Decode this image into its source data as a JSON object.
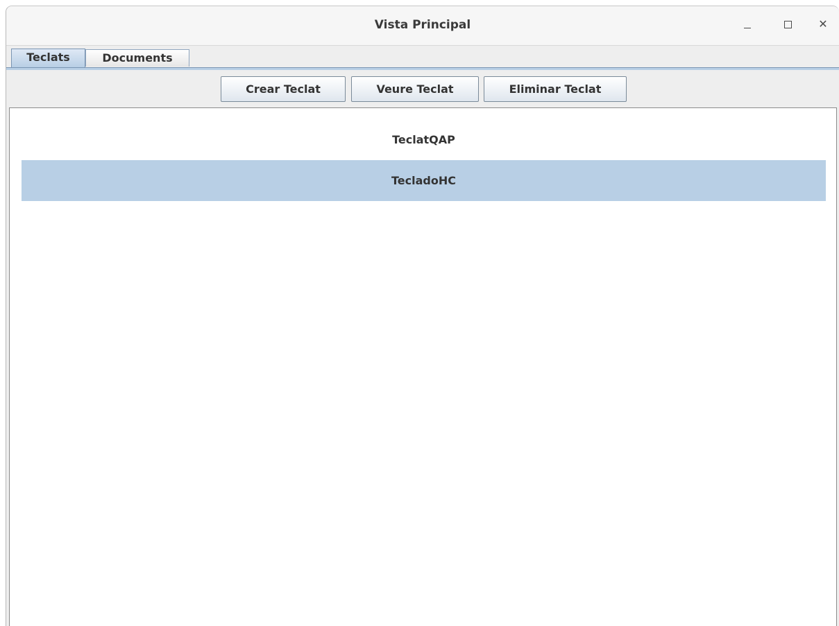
{
  "window": {
    "title": "Vista Principal",
    "controls": {
      "minimize": "minimize-icon",
      "maximize": "maximize-icon",
      "close": "close-icon",
      "close_glyph": "✕"
    }
  },
  "tabs": [
    {
      "label": "Teclats",
      "selected": true
    },
    {
      "label": "Documents",
      "selected": false
    }
  ],
  "toolbar": {
    "create_label": "Crear Teclat",
    "view_label": "Veure Teclat",
    "delete_label": "Eliminar Teclat"
  },
  "keyboards": [
    {
      "name": "TeclatQAP",
      "selected": false
    },
    {
      "name": "TecladoHC",
      "selected": true
    }
  ],
  "colors": {
    "selection": "#b8cfe5",
    "tab_border": "#7a95b3"
  }
}
